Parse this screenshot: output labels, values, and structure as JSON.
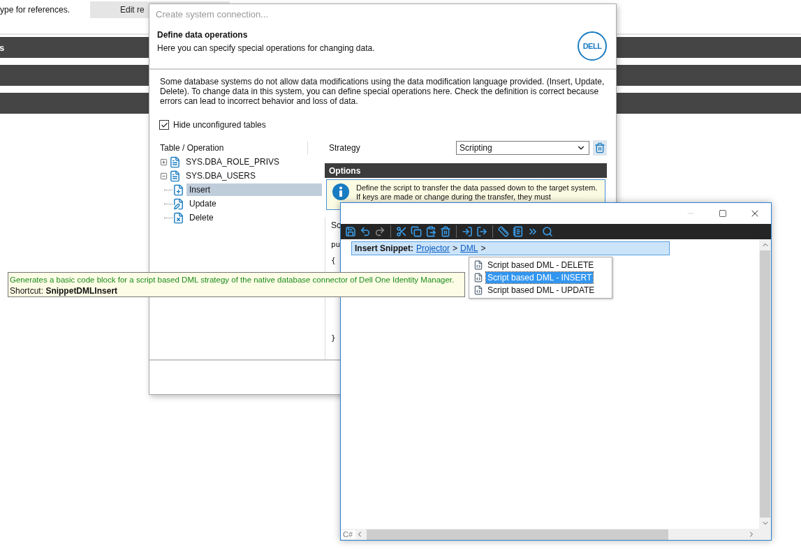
{
  "background": {
    "caption": "ype for references.",
    "edit_button": "Edit re",
    "section_bars": [
      {
        "kind": "labeled",
        "label": "s"
      },
      {
        "kind": "plain"
      },
      {
        "kind": "plain"
      }
    ]
  },
  "dialog": {
    "title": "Create system connection...",
    "heading": "Define data operations",
    "subtitle": "Here you can specify special operations for changing data.",
    "logo": "DELL",
    "description": "Some database systems do not allow data modifications using the data modification language provided. (Insert, Update, Delete). To change data in this system, you can define special operations here. Check the definition is correct because errors can lead to incorrect behavior and loss of data.",
    "hide_unconfigured": {
      "label": "Hide unconfigured tables",
      "checked": true
    },
    "tree": {
      "heading": "Table / Operation",
      "items": [
        {
          "label": "SYS.DBA_ROLE_PRIVS",
          "expanded": false,
          "selected": false
        },
        {
          "label": "SYS.DBA_USERS",
          "expanded": true,
          "selected": false,
          "children": [
            {
              "label": "Insert",
              "kind": "insert",
              "selected": true
            },
            {
              "label": "Update",
              "kind": "update",
              "selected": false
            },
            {
              "label": "Delete",
              "kind": "delete",
              "selected": false
            }
          ]
        }
      ]
    },
    "strategy": {
      "label": "Strategy",
      "value": "Scripting"
    },
    "options": {
      "heading": "Options",
      "info": "Define the script to transfer the data passed down to the target system. If keys are made or change during the transfer, they must",
      "script_label": "Sc",
      "code_lines": [
        "pu",
        "{",
        "}"
      ]
    }
  },
  "editor": {
    "snippet": {
      "label": "Insert Snippet:",
      "path": [
        {
          "label": "Projector",
          "separator": ">"
        },
        {
          "label": "DML",
          "separator": ">"
        }
      ]
    },
    "language": "C#"
  },
  "snippet_list": [
    {
      "label": "Script based DML - DELETE",
      "selected": false
    },
    {
      "label": "Script based DML - INSERT",
      "selected": true
    },
    {
      "label": "Script based DML - UPDATE",
      "selected": false
    }
  ],
  "tooltip": {
    "description": "Generates a basic code block for a script based DML strategy of the native database connector of Dell One Identity Manager.",
    "shortcut_label": "Shortcut:",
    "shortcut": "SnippetDMLInsert"
  }
}
